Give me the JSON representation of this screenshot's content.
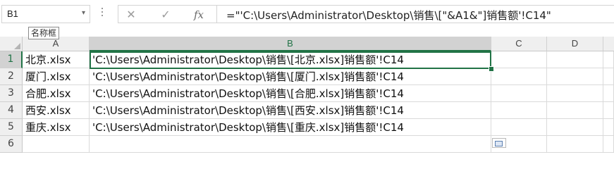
{
  "name_box": {
    "value": "B1"
  },
  "formula_bar": {
    "cancel_icon": "close-icon",
    "enter_icon": "checkmark-icon",
    "fx_label": "fx",
    "formula": "=\"'C:\\Users\\Administrator\\Desktop\\销售\\[\"&A1&\"]销售额'!C14\""
  },
  "tooltip": {
    "text": "名称框"
  },
  "columns": [
    "A",
    "B",
    "C",
    "D"
  ],
  "selected_column": "B",
  "rows": [
    {
      "num": "1",
      "a": "北京.xlsx",
      "b": "'C:\\Users\\Administrator\\Desktop\\销售\\[北京.xlsx]销售额'!C14"
    },
    {
      "num": "2",
      "a": "厦门.xlsx",
      "b": "'C:\\Users\\Administrator\\Desktop\\销售\\[厦门.xlsx]销售额'!C14"
    },
    {
      "num": "3",
      "a": "合肥.xlsx",
      "b": "'C:\\Users\\Administrator\\Desktop\\销售\\[合肥.xlsx]销售额'!C14"
    },
    {
      "num": "4",
      "a": "西安.xlsx",
      "b": "'C:\\Users\\Administrator\\Desktop\\销售\\[西安.xlsx]销售额'!C14"
    },
    {
      "num": "5",
      "a": "重庆.xlsx",
      "b": "'C:\\Users\\Administrator\\Desktop\\销售\\[重庆.xlsx]销售额'!C14"
    },
    {
      "num": "6",
      "a": "",
      "b": ""
    }
  ],
  "colors": {
    "accent": "#217346",
    "header_bg": "#efefef",
    "selected_header_bg": "#d2d2d2"
  }
}
